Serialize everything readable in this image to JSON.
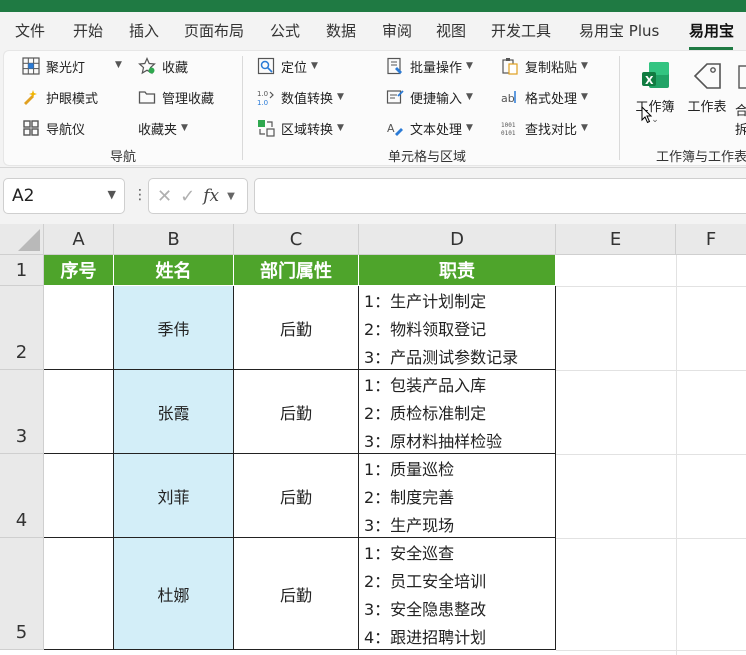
{
  "menu": {
    "tabs": [
      "文件",
      "开始",
      "插入",
      "页面布局",
      "公式",
      "数据",
      "审阅",
      "视图",
      "开发工具",
      "易用宝 Plus",
      "易用宝"
    ],
    "active_tab": "易用宝"
  },
  "ribbon": {
    "nav_group": {
      "label": "导航",
      "items": [
        {
          "label": "聚光灯",
          "icon": "spotlight-grid-icon"
        },
        {
          "label": "护眼模式",
          "icon": "eye-protect-icon"
        },
        {
          "label": "导航仪",
          "icon": "navigator-icon"
        },
        {
          "label": "收藏",
          "icon": "star-icon"
        },
        {
          "label": "管理收藏",
          "icon": "folder-icon"
        },
        {
          "label": "收藏夹"
        }
      ]
    },
    "cell_group": {
      "label": "单元格与区域",
      "items": [
        {
          "label": "定位",
          "icon": "locate-icon"
        },
        {
          "label": "数值转换",
          "icon": "number-convert-icon"
        },
        {
          "label": "区域转换",
          "icon": "range-convert-icon"
        },
        {
          "label": "批量操作",
          "icon": "batch-icon"
        },
        {
          "label": "便捷输入",
          "icon": "quick-input-icon"
        },
        {
          "label": "文本处理",
          "icon": "text-process-icon"
        },
        {
          "label": "复制粘贴",
          "icon": "copy-paste-icon"
        },
        {
          "label": "格式处理",
          "icon": "format-icon"
        },
        {
          "label": "查找对比",
          "icon": "compare-icon"
        }
      ]
    },
    "book_group": {
      "label": "工作簿与工作表",
      "workbook_label": "工作簿",
      "worksheet_label": "工作表",
      "partial_label_1": "合",
      "partial_label_2": "拆"
    }
  },
  "formula_bar": {
    "name_box": "A2",
    "fx": "fx",
    "formula": ""
  },
  "sheet": {
    "columns": [
      "A",
      "B",
      "C",
      "D",
      "E",
      "F"
    ],
    "rows": [
      "1",
      "2",
      "3",
      "4",
      "5"
    ],
    "header": [
      "序号",
      "姓名",
      "部门属性",
      "职责"
    ],
    "records": [
      {
        "seq": "",
        "name": "季伟",
        "dept": "后勤",
        "duties": [
          "1：生产计划制定",
          "2：物料领取登记",
          "3：产品测试参数记录"
        ]
      },
      {
        "seq": "",
        "name": "张霞",
        "dept": "后勤",
        "duties": [
          "1：包装产品入库",
          "2：质检标准制定",
          "3：原材料抽样检验"
        ]
      },
      {
        "seq": "",
        "name": "刘菲",
        "dept": "后勤",
        "duties": [
          "1：质量巡检",
          "2：制度完善",
          "3：生产现场"
        ]
      },
      {
        "seq": "",
        "name": "杜娜",
        "dept": "后勤",
        "duties": [
          "1：安全巡查",
          "2：员工安全培训",
          "3：安全隐患整改",
          "4：跟进招聘计划"
        ]
      }
    ]
  },
  "colors": {
    "accent": "#1f7a43",
    "header_fill": "#4ea42b",
    "name_fill": "#d3eef8"
  }
}
